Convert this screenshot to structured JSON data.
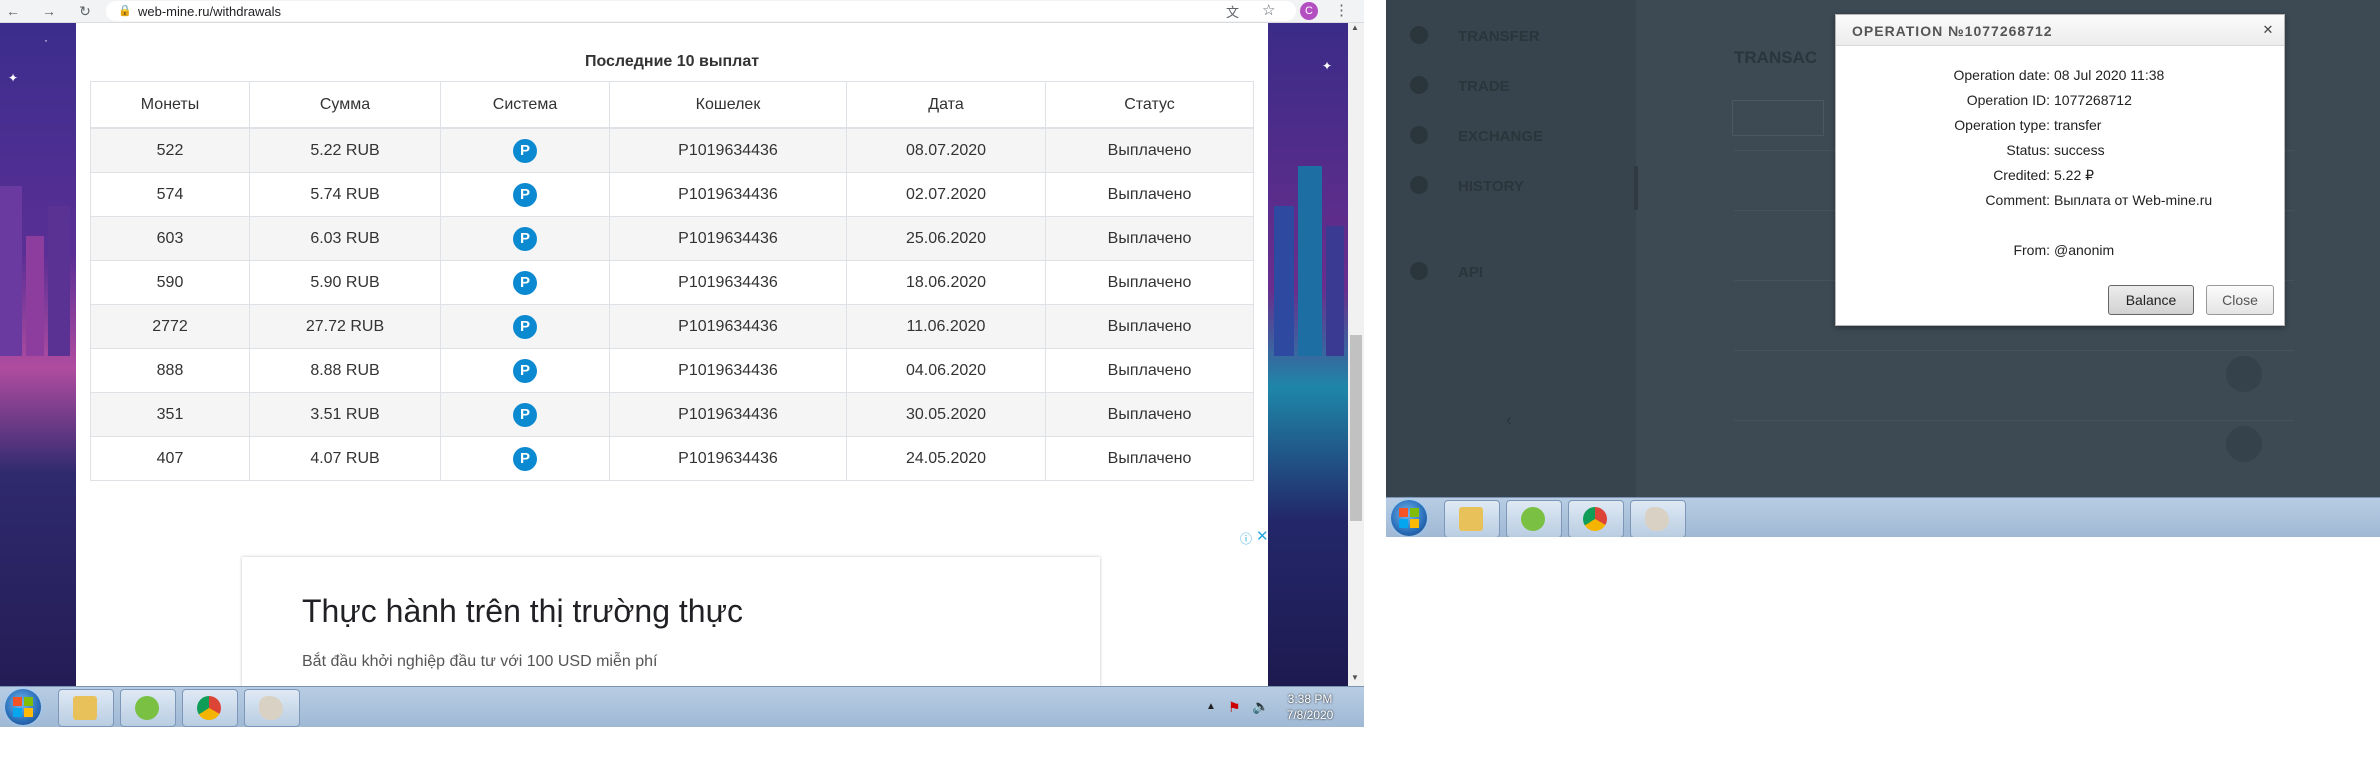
{
  "browser": {
    "url": "web-mine.ru/withdrawals",
    "profile_initial": "C"
  },
  "page": {
    "table_title": "Последние 10 выплат",
    "columns": [
      "Монеты",
      "Сумма",
      "Система",
      "Кошелек",
      "Дата",
      "Статус"
    ],
    "rows": [
      {
        "coins": "522",
        "amount": "5.22 RUB",
        "system": "P",
        "wallet": "P1019634436",
        "date": "08.07.2020",
        "status": "Выплачено"
      },
      {
        "coins": "574",
        "amount": "5.74 RUB",
        "system": "P",
        "wallet": "P1019634436",
        "date": "02.07.2020",
        "status": "Выплачено"
      },
      {
        "coins": "603",
        "amount": "6.03 RUB",
        "system": "P",
        "wallet": "P1019634436",
        "date": "25.06.2020",
        "status": "Выплачено"
      },
      {
        "coins": "590",
        "amount": "5.90 RUB",
        "system": "P",
        "wallet": "P1019634436",
        "date": "18.06.2020",
        "status": "Выплачено"
      },
      {
        "coins": "2772",
        "amount": "27.72 RUB",
        "system": "P",
        "wallet": "P1019634436",
        "date": "11.06.2020",
        "status": "Выплачено"
      },
      {
        "coins": "888",
        "amount": "8.88 RUB",
        "system": "P",
        "wallet": "P1019634436",
        "date": "04.06.2020",
        "status": "Выплачено"
      },
      {
        "coins": "351",
        "amount": "3.51 RUB",
        "system": "P",
        "wallet": "P1019634436",
        "date": "30.05.2020",
        "status": "Выплачено"
      },
      {
        "coins": "407",
        "amount": "4.07 RUB",
        "system": "P",
        "wallet": "P1019634436",
        "date": "24.05.2020",
        "status": "Выплачено"
      }
    ]
  },
  "ad": {
    "title": "Thực hành trên thị trường thực",
    "subtitle": "Bắt đầu khởi nghiệp đầu tư với 100 USD miễn phí"
  },
  "taskbar": {
    "time": "3:38 PM",
    "date": "7/8/2020",
    "apps": [
      "file-explorer",
      "app-green",
      "chrome",
      "paint"
    ]
  },
  "background_app": {
    "sidebar": [
      "TRANSFER",
      "TRADE",
      "EXCHANGE",
      "HISTORY",
      "API"
    ],
    "heading": "TRANSAC"
  },
  "modal": {
    "title": "OPERATION №1077268712",
    "fields": {
      "operation_date": {
        "label": "Operation date:",
        "value": "08 Jul 2020 11:38"
      },
      "operation_id": {
        "label": "Operation ID:",
        "value": "1077268712"
      },
      "operation_type": {
        "label": "Operation type:",
        "value": "transfer"
      },
      "status": {
        "label": "Status:",
        "value": "success"
      },
      "credited": {
        "label": "Credited:",
        "value": "5.22 ₽"
      },
      "comment": {
        "label": "Comment:",
        "value": "Выплата от Web-mine.ru"
      },
      "from": {
        "label": "From:",
        "value": "@anonim"
      }
    },
    "balance_label": "Balance",
    "close_label": "Close"
  },
  "colors": {
    "system_icon": "#0c8ad1",
    "taskbar": "#b8cde3",
    "dim_overlay": "#3d4a54"
  }
}
